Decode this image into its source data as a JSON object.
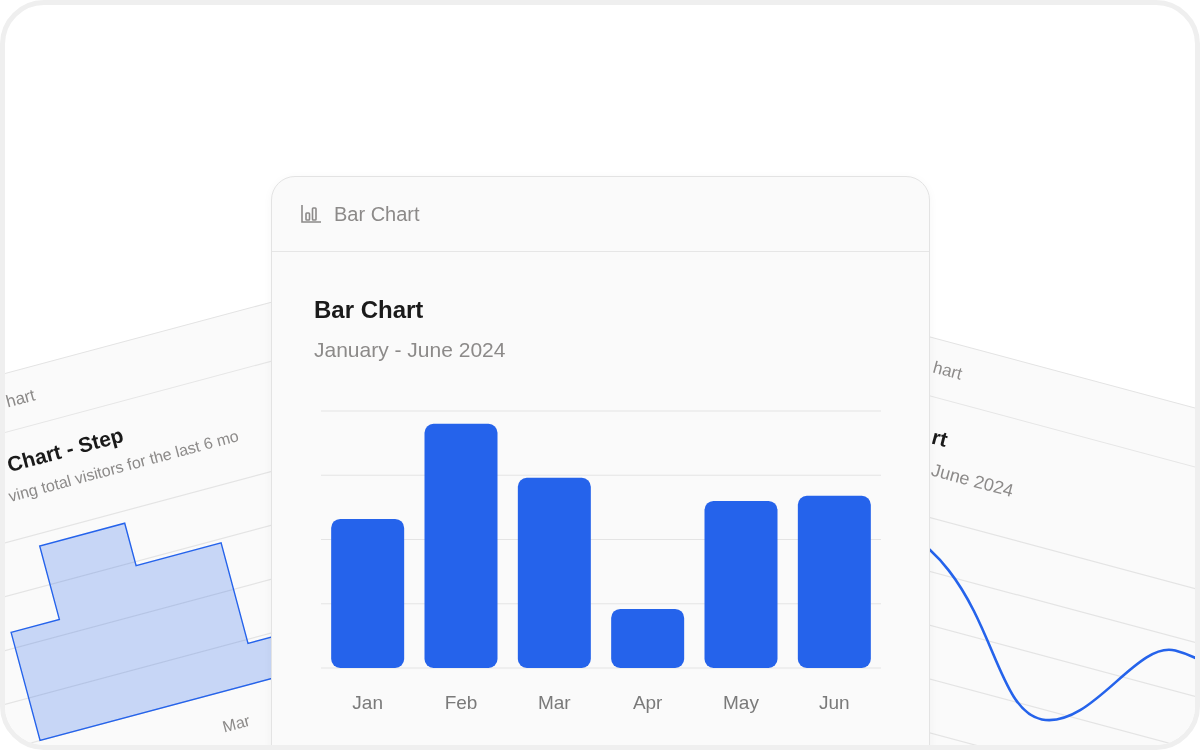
{
  "left_card": {
    "header": "hart",
    "title": "Chart - Step",
    "subtitle": "ving total visitors for the last 6 mo",
    "x_labels": [
      "Mar"
    ]
  },
  "right_card": {
    "header": "hart",
    "title": "rt",
    "subtitle": "June 2024"
  },
  "center_card": {
    "header": "Bar Chart",
    "title": "Bar Chart",
    "subtitle": "January - June 2024",
    "bars": [
      {
        "label": "Jan",
        "level": 0.58
      },
      {
        "label": "Feb",
        "level": 0.95
      },
      {
        "label": "Mar",
        "level": 0.74
      },
      {
        "label": "Apr",
        "level": 0.23
      },
      {
        "label": "May",
        "level": 0.65
      },
      {
        "label": "Jun",
        "level": 0.67
      }
    ]
  }
}
